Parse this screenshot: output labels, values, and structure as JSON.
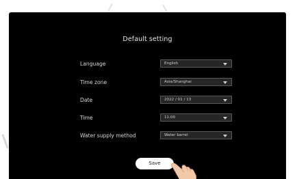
{
  "dialog": {
    "title": "Default setting"
  },
  "settings": [
    {
      "label": "Language",
      "value": "English"
    },
    {
      "label": "Time zone",
      "value": "Asia/Shanghai"
    },
    {
      "label": "Date",
      "value": "2022 / 01 / 13"
    },
    {
      "label": "Time",
      "value": "11:00"
    },
    {
      "label": "Water supply method",
      "value": "Water barrel"
    }
  ],
  "actions": {
    "save_label": "Save"
  },
  "icons": {
    "dropdown": "chevron-down-icon",
    "pointer": "hand-pointer-icon"
  },
  "colors": {
    "screen_background": "#000000",
    "field_background": "#262626",
    "button_background": "#ffffff"
  }
}
